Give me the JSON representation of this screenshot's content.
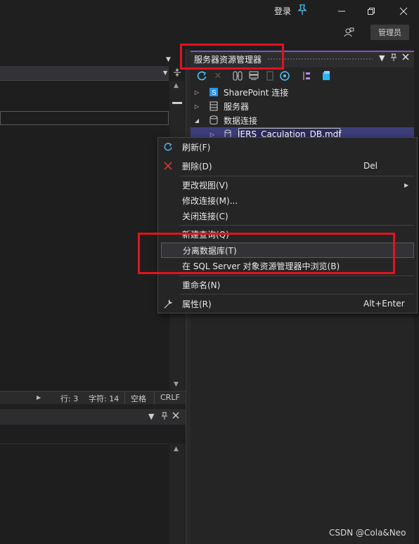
{
  "titlebar": {
    "login": "登录",
    "admin_badge": "管理员"
  },
  "icons": {
    "pin": "pushpin-icon",
    "minimize": "minimize-icon",
    "restore": "restore-icon",
    "close": "close-icon",
    "feedback": "feedback-person-icon"
  },
  "status_bar": {
    "line": "行: 3",
    "char": "字符: 14",
    "whitespace": "空格",
    "eol": "CRLF"
  },
  "server_explorer": {
    "title": "服务器资源管理器",
    "tree": [
      {
        "label": "SharePoint 连接",
        "expander": "collapsed",
        "icon": "sharepoint-icon"
      },
      {
        "label": "服务器",
        "expander": "collapsed",
        "icon": "server-icon"
      },
      {
        "label": "数据连接",
        "expander": "expanded",
        "icon": "data-connection-icon"
      },
      {
        "label": "IERS_Caculation_DB.mdf",
        "expander": "collapsed",
        "icon": "database-icon",
        "selected": true
      }
    ]
  },
  "context_menu": {
    "items": [
      {
        "label": "刷新(F)",
        "shortcut": "",
        "icon": "refresh-icon"
      },
      {
        "label": "删除(D)",
        "shortcut": "Del",
        "icon": "delete-icon"
      },
      {
        "label": "更改视图(V)",
        "shortcut": "",
        "submenu": true
      },
      {
        "label": "修改连接(M)...",
        "shortcut": ""
      },
      {
        "label": "关闭连接(C)",
        "shortcut": ""
      },
      {
        "label": "新建查询(Q)",
        "shortcut": ""
      },
      {
        "label": "分离数据库(T)",
        "shortcut": "",
        "highlighted": true
      },
      {
        "label": "在 SQL Server 对象资源管理器中浏览(B)",
        "shortcut": ""
      },
      {
        "label": "重命名(N)",
        "shortcut": ""
      },
      {
        "label": "属性(R)",
        "shortcut": "Alt+Enter",
        "icon": "wrench-icon"
      }
    ]
  },
  "colors": {
    "background": "#1f1f1f",
    "panel": "#252526",
    "accent": "#7e57c2",
    "selection": "#3d3d79",
    "annotation_red": "#e0141e",
    "refresh_blue": "#4fc3f7",
    "delete_red": "#e53935"
  },
  "watermark": "CSDN @Cola&Neo"
}
